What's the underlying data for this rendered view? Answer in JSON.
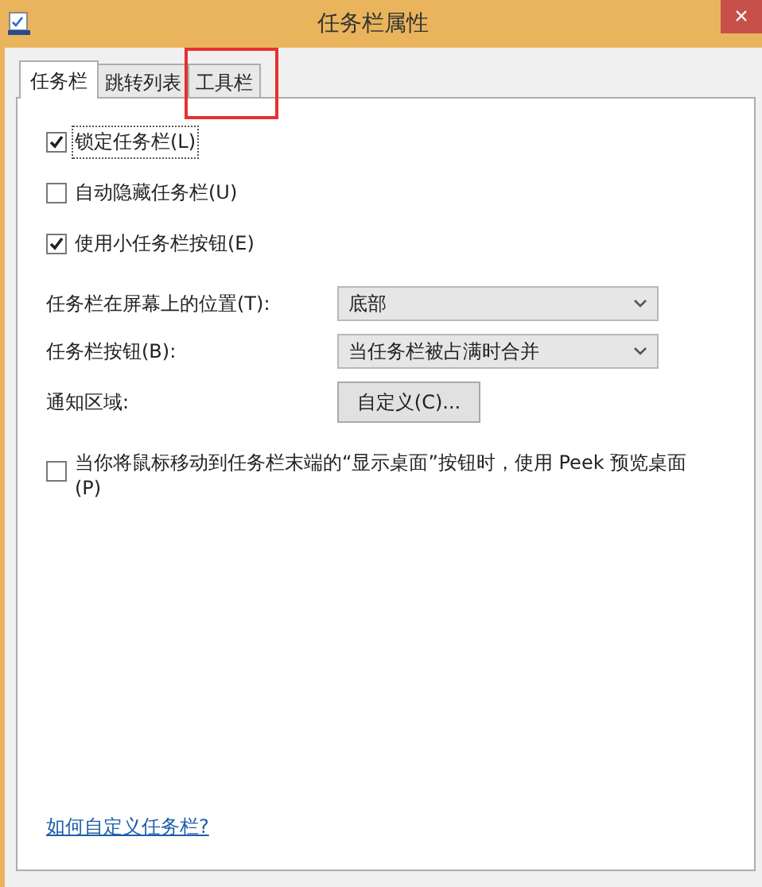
{
  "window": {
    "title": "任务栏属性",
    "close": "×"
  },
  "tabs": [
    {
      "label": "任务栏",
      "selected": true,
      "highlighted": false
    },
    {
      "label": "跳转列表",
      "selected": false,
      "highlighted": false
    },
    {
      "label": "工具栏",
      "selected": false,
      "highlighted": true
    }
  ],
  "options": [
    {
      "label": "锁定任务栏(L)",
      "checked": true,
      "focused": true
    },
    {
      "label": "自动隐藏任务栏(U)",
      "checked": false,
      "focused": false
    },
    {
      "label": "使用小任务栏按钮(E)",
      "checked": true,
      "focused": false
    }
  ],
  "settings": [
    {
      "kind": "dropdown",
      "label": "任务栏在屏幕上的位置(T):",
      "value": "底部"
    },
    {
      "kind": "dropdown",
      "label": "任务栏按钮(B):",
      "value": "当任务栏被占满时合并"
    },
    {
      "kind": "button",
      "label": "通知区域:",
      "value": "自定义(C)..."
    }
  ],
  "peek": {
    "label": "当你将鼠标移动到任务栏末端的“显示桌面”按钮时，使用 Peek 预览桌面(P)",
    "checked": false
  },
  "help_link": "如何自定义任务栏?"
}
